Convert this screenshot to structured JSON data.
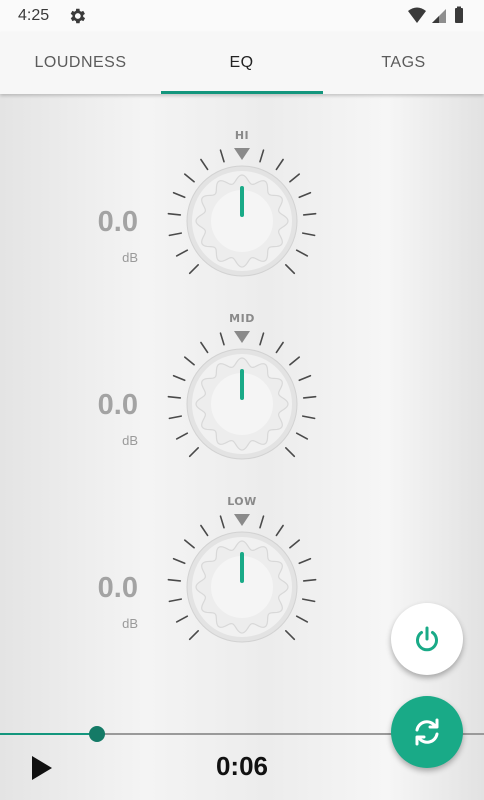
{
  "status_bar": {
    "time": "4:25",
    "icons": [
      "gear-icon",
      "wifi-icon",
      "cellular-icon",
      "battery-icon"
    ]
  },
  "tabs": [
    {
      "label": "LOUDNESS",
      "active": false
    },
    {
      "label": "EQ",
      "active": true
    },
    {
      "label": "TAGS",
      "active": false
    }
  ],
  "eq": {
    "bands": [
      {
        "label": "HI",
        "value": "0.0",
        "unit": "dB"
      },
      {
        "label": "MID",
        "value": "0.0",
        "unit": "dB"
      },
      {
        "label": "LOW",
        "value": "0.0",
        "unit": "dB"
      }
    ]
  },
  "buttons": {
    "power_icon": "power-icon",
    "sync_icon": "sync-icon"
  },
  "player": {
    "time": "0:06",
    "progress_fraction": 0.2,
    "play_icon": "play-icon"
  },
  "colors": {
    "accent": "#13967d",
    "fab_green": "#19aa87",
    "fab_white": "#ffffff"
  }
}
